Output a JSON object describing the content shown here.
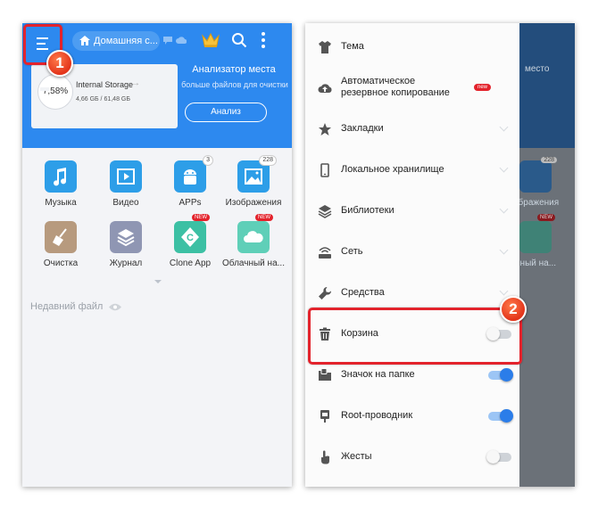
{
  "left_screen": {
    "header": {
      "home_tab": "Домашняя с...",
      "storage": {
        "percent": "7,58%",
        "name": "Internal Storage",
        "size": "4,66 GБ / 61,48 GБ"
      },
      "analyzer": {
        "title": "Анализатор места",
        "subtitle": "больше файлов для очистки",
        "button": "Анализ"
      }
    },
    "apps": [
      {
        "label": "Музыка",
        "icon": "music-icon",
        "color": "#2d9ee8"
      },
      {
        "label": "Видео",
        "icon": "video-icon",
        "color": "#2d9ee8"
      },
      {
        "label": "APPs",
        "icon": "android-icon",
        "color": "#2d9ee8",
        "count": "3"
      },
      {
        "label": "Изображения",
        "icon": "image-icon",
        "color": "#2d9ee8",
        "count": "228"
      },
      {
        "label": "Очистка",
        "icon": "broom-icon",
        "color": "#b79a7e"
      },
      {
        "label": "Журнал",
        "icon": "layers-icon",
        "color": "#8f96b3"
      },
      {
        "label": "Clone App",
        "icon": "clone-icon",
        "color": "#3cc0a4",
        "badge": "NEW"
      },
      {
        "label": "Облачный на...",
        "icon": "cloud-icon",
        "color": "#5fcfb8",
        "badge": "NEW"
      }
    ],
    "recent_label": "Недавний файл"
  },
  "right_screen": {
    "behind": {
      "title": "место",
      "apps_label": "ображения",
      "count": "228",
      "badge": "NEW",
      "cloud_label": "ачный на..."
    },
    "drawer_items": [
      {
        "label": "Тема",
        "icon": "shirt-icon"
      },
      {
        "label": "Автоматическое резервное копирование",
        "line1": "Автоматическое",
        "line2": "резервное копирование",
        "icon": "cloud-upload-icon",
        "badge": "new"
      },
      {
        "label": "Закладки",
        "icon": "star-icon"
      },
      {
        "label": "Локальное хранилище",
        "icon": "phone-icon"
      },
      {
        "label": "Библиотеки",
        "icon": "library-icon"
      },
      {
        "label": "Сеть",
        "icon": "network-icon"
      },
      {
        "label": "Средства",
        "icon": "wrench-icon"
      },
      {
        "label": "Корзина",
        "icon": "trash-icon",
        "toggle": "off"
      },
      {
        "label": "Значок на папке",
        "icon": "folder-badge-icon",
        "toggle": "on"
      },
      {
        "label": "Root-проводник",
        "icon": "root-icon",
        "toggle": "on"
      },
      {
        "label": "Жесты",
        "icon": "gesture-icon",
        "toggle": "off"
      }
    ]
  },
  "annotations": {
    "step1": "1",
    "step2": "2",
    "highlight_color": "#e3232c"
  }
}
